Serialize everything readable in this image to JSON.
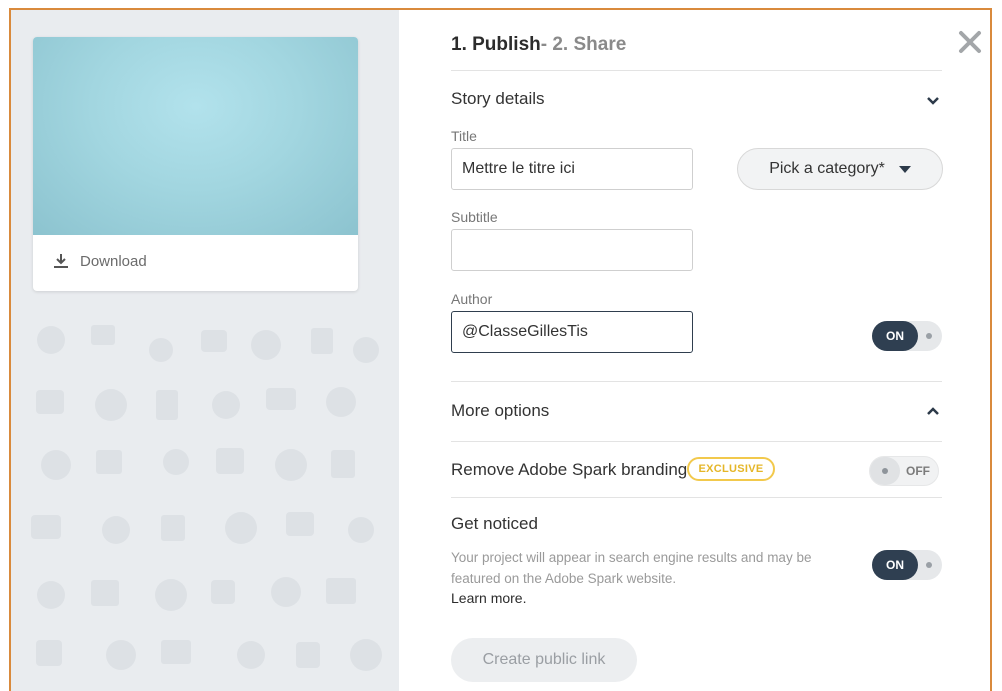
{
  "header": {
    "step1": "1. Publish",
    "step2": "- 2. Share"
  },
  "preview": {
    "download_label": "Download"
  },
  "story_details": {
    "section_title": "Story details",
    "title_label": "Title",
    "title_value": "Mettre le titre ici",
    "category_label": "Pick a category*",
    "subtitle_label": "Subtitle",
    "subtitle_value": "",
    "author_label": "Author",
    "author_value": "@ClasseGillesTis",
    "author_toggle": "ON"
  },
  "more_options": {
    "section_title": "More options",
    "branding_label": "Remove Adobe Spark branding",
    "branding_badge": "EXCLUSIVE",
    "branding_toggle": "OFF",
    "noticed_label": "Get noticed",
    "noticed_desc": "Your project will appear in search engine results and may be featured on the Adobe Spark website.",
    "learn_more": "Learn more.",
    "noticed_toggle": "ON",
    "create_link_button": "Create public link"
  },
  "colors": {
    "accent_dark": "#2f3f51",
    "frame_border": "#d98a3c",
    "exclusive": "#f2c94c",
    "preview": "#a2d6e0"
  }
}
